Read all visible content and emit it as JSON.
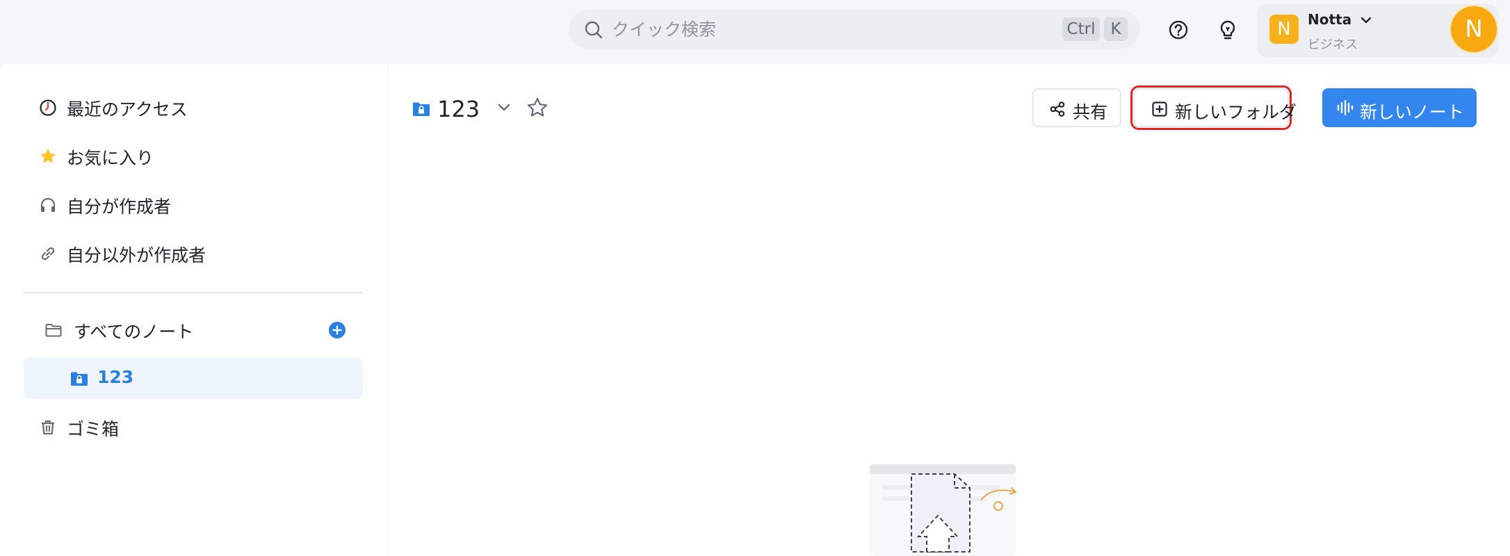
{
  "search": {
    "placeholder": "クイック検索",
    "shortcut_ctrl": "Ctrl",
    "shortcut_key": "K"
  },
  "icons": {
    "help": "help-circle-icon",
    "tips": "lightbulb-icon",
    "recent": "clock-icon",
    "favorites": "star-filled-icon",
    "mine": "headphones-icon",
    "shared": "link-icon",
    "all_notes": "folder-icon",
    "add": "plus-circle-icon",
    "folder_locked": "locked-folder-icon",
    "trash": "trash-icon",
    "share": "share-icon",
    "new_folder": "folder-plus-icon",
    "new_note": "waveform-icon",
    "favorite_outline": "star-outline-icon"
  },
  "account": {
    "badge": "N",
    "name": "Notta",
    "plan": "ビジネス",
    "avatar": "N"
  },
  "sidebar": {
    "recent": "最近のアクセス",
    "favorites": "お気に入り",
    "mine": "自分が作成者",
    "others": "自分以外が作成者",
    "all_notes": "すべてのノート",
    "folder": "123",
    "trash": "ゴミ箱"
  },
  "main": {
    "folder_name": "123",
    "share_label": "共有",
    "new_folder_label": "新しいフォルダ",
    "new_note_label": "新しいノート"
  },
  "colors": {
    "accent": "#3386ed",
    "active_bg": "#eef5fd",
    "avatar": "#f7a90f",
    "highlight_border": "#e02424",
    "star": "#f9c623"
  }
}
